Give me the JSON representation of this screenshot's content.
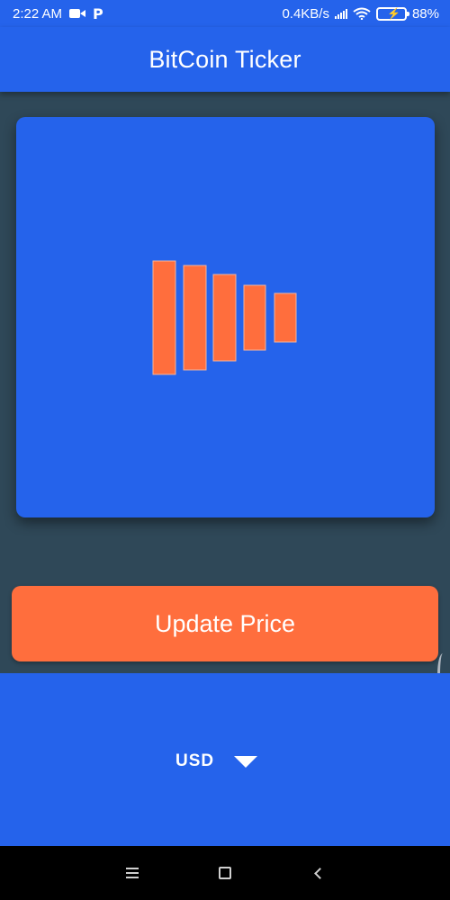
{
  "status_bar": {
    "time": "2:22 AM",
    "network_speed": "0.4KB/s",
    "battery": "88%",
    "icons": [
      "video-camera-icon",
      "p-notification-icon",
      "signal-icon",
      "wifi-icon",
      "battery-charging-icon"
    ]
  },
  "app_bar": {
    "title": "BitCoin Ticker"
  },
  "card": {
    "icon": "bar-chart-logo-icon",
    "bar_color": "#ff6e3d"
  },
  "update_button": {
    "label": "Update Price"
  },
  "currency_selector": {
    "selected": "USD",
    "icon": "dropdown-triangle-icon"
  },
  "nav_bar": {
    "icons": [
      "menu-icon",
      "home-icon",
      "back-icon"
    ]
  },
  "colors": {
    "primary": "#2563eb",
    "accent": "#ff6e3d",
    "background": "#2f4858",
    "nav": "#000000"
  }
}
